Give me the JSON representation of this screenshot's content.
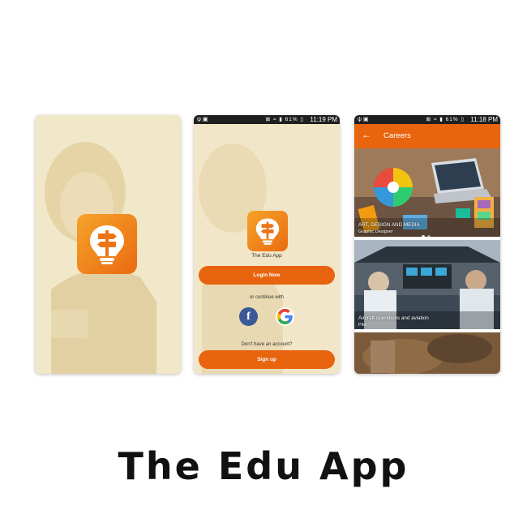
{
  "headline": "The Edu App",
  "login_screen": {
    "status_time": "11:19 PM",
    "status_battery": "61%",
    "app_name": "The Edu App",
    "login_button": "Login Now",
    "continue_text": "or continue with",
    "facebook_glyph": "f",
    "no_account_text": "Don't have an account?",
    "signup_button": "Sign up"
  },
  "careers_screen": {
    "status_time": "11:18 PM",
    "status_battery": "61%",
    "title": "Careers",
    "cards": [
      {
        "category": "ART, DESIGN AND MEDIA",
        "role": "Graphic Designer"
      },
      {
        "category": "Aircraft operations and aviation",
        "role": "Pilot"
      }
    ]
  },
  "colors": {
    "accent": "#e8640e",
    "cream": "#f2e6c8"
  },
  "icons": [
    "lightbulb-signpost-logo",
    "back-arrow-icon",
    "facebook-icon",
    "google-icon"
  ]
}
